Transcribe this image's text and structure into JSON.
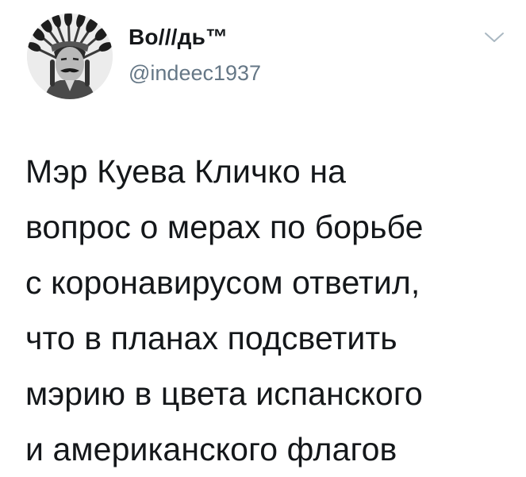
{
  "user": {
    "display_name": "Во///дь™",
    "handle": "@indeec1937",
    "avatar_icon": "headdress-portrait-avatar"
  },
  "menu": {
    "icon": "chevron-down-icon"
  },
  "tweet": {
    "lines": [
      "Мэр Куева Кличко на",
      "вопрос о мерах по борьбе",
      "с коронавирусом ответил,",
      "что в планах подсветить",
      "мэрию в цвета испанского",
      "и американского флагов"
    ]
  },
  "colors": {
    "text": "#14171a",
    "secondary": "#657786",
    "background": "#ffffff"
  }
}
